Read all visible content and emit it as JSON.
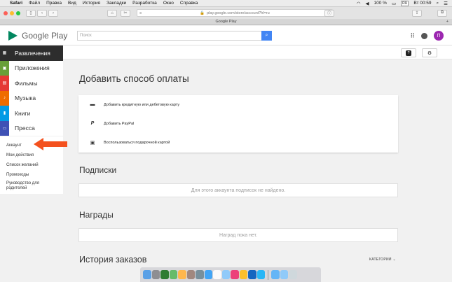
{
  "menubar": {
    "app": "Safari",
    "items": [
      "Файл",
      "Правка",
      "Вид",
      "История",
      "Закладки",
      "Разработка",
      "Окно",
      "Справка"
    ],
    "battery": "100 %",
    "lang": "RU",
    "clock": "Вт 00:59"
  },
  "browser": {
    "url": "play.google.com/store/account?hl=ru",
    "tab_title": "Google Play"
  },
  "header": {
    "logo_text": "Google Play",
    "search_placeholder": "Поиск",
    "avatar_letter": "П"
  },
  "sidebar": {
    "categories": [
      {
        "label": "Развлечения",
        "color": "#2d2d2d",
        "active": true
      },
      {
        "label": "Приложения",
        "color": "#689f38",
        "active": false
      },
      {
        "label": "Фильмы",
        "color": "#e53935",
        "active": false
      },
      {
        "label": "Музыка",
        "color": "#ef6c00",
        "active": false
      },
      {
        "label": "Книги",
        "color": "#039be5",
        "active": false
      },
      {
        "label": "Пресса",
        "color": "#3f51b5",
        "active": false
      }
    ],
    "links": [
      "Аккаунт",
      "Мои действия",
      "Список желаний",
      "Промокоды",
      "Руководство для родителей"
    ]
  },
  "main": {
    "payment_title": "Добавить способ оплаты",
    "payment_options": [
      {
        "icon": "credit-card-icon",
        "label": "Добавить кредитную или дебетовую карту"
      },
      {
        "icon": "paypal-icon",
        "label": "Добавить PayPal"
      },
      {
        "icon": "gift-card-icon",
        "label": "Воспользоваться подарочной картой"
      }
    ],
    "subscriptions_title": "Подписки",
    "subscriptions_empty": "Для этого аккаунта подписок не найдено.",
    "rewards_title": "Награды",
    "rewards_empty": "Наград пока нет.",
    "orders_title": "История заказов",
    "categories_label": "КАТЕГОРИИ"
  },
  "colors": {
    "accent_blue": "#4285f4",
    "arrow": "#f4511e"
  }
}
